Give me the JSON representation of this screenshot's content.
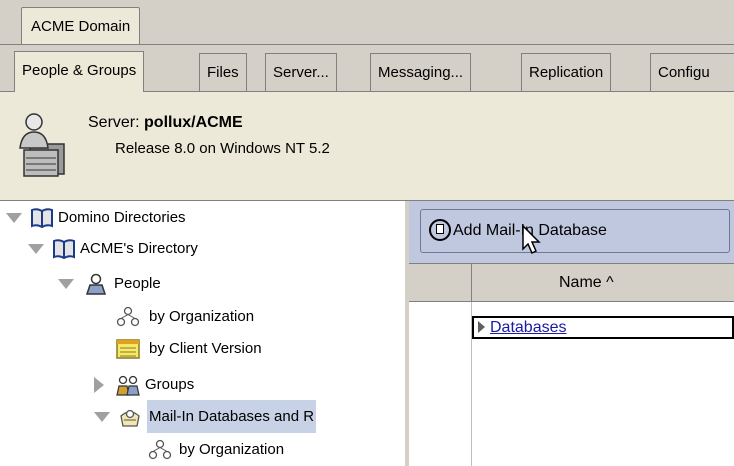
{
  "domain_tab": "ACME Domain",
  "tabs": [
    "People & Groups",
    "Files",
    "Server...",
    "Messaging...",
    "Replication",
    "Configu"
  ],
  "server": {
    "prefix": "Server: ",
    "name": "pollux/ACME",
    "release": "Release 8.0 on Windows NT 5.2"
  },
  "nav": {
    "items": [
      {
        "label": "Domino Directories",
        "icon": "book-icon",
        "twisty": "open"
      },
      {
        "label": "ACME's Directory",
        "icon": "book-icon",
        "twisty": "open"
      },
      {
        "label": "People",
        "icon": "person-icon",
        "twisty": "open"
      },
      {
        "label": "by Organization",
        "icon": "hierarchy-icon",
        "twisty": "none"
      },
      {
        "label": "by Client Version",
        "icon": "view-icon",
        "twisty": "none"
      },
      {
        "label": "Groups",
        "icon": "group-icon",
        "twisty": "closed"
      },
      {
        "label": "Mail-In Databases and R",
        "icon": "mailin-icon",
        "twisty": "open",
        "selected": true
      },
      {
        "label": "by Organization",
        "icon": "hierarchy-icon",
        "twisty": "none"
      }
    ]
  },
  "view": {
    "action_button": "Add Mail-In Database",
    "column_header": "Name ^",
    "rows": [
      "Databases"
    ]
  },
  "colors": {
    "chrome": "#d4d0c8",
    "action_bar": "#c0c8e0",
    "selection": "#c8d2e6",
    "link": "#1a1aa6"
  }
}
